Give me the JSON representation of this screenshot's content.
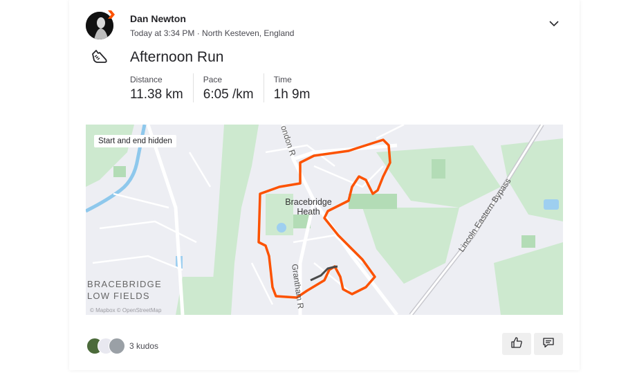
{
  "athlete": {
    "name": "Dan Newton",
    "meta": "Today at 3:34 PM · North Kesteven, England"
  },
  "activity": {
    "title": "Afternoon Run",
    "stats": [
      {
        "label": "Distance",
        "value": "11.38 km"
      },
      {
        "label": "Pace",
        "value": "6:05 /km"
      },
      {
        "label": "Time",
        "value": "1h 9m"
      }
    ]
  },
  "map": {
    "privacy_chip": "Start and end hidden",
    "place_label_line1": "Bracebridge",
    "place_label_line2": "Heath",
    "district_line1": "BRACEBRIDGE",
    "district_line2": "LOW FIELDS",
    "road_labels": {
      "london_road": "ondon R",
      "grantham_road": "Grantham R",
      "bypass": "Lincoln Eastern Bypass"
    },
    "attribution": "© Mapbox © OpenStreetMap",
    "route_color": "#fc5200",
    "hidden_segment_color": "#4a4a4a"
  },
  "social": {
    "kudos_count": "3 kudos"
  },
  "icons": {
    "sport": "running-shoe-icon",
    "menu": "chevron-down-icon",
    "kudos": "thumbs-up-icon",
    "comment": "comment-icon",
    "badge": "subscriber-badge-icon"
  }
}
